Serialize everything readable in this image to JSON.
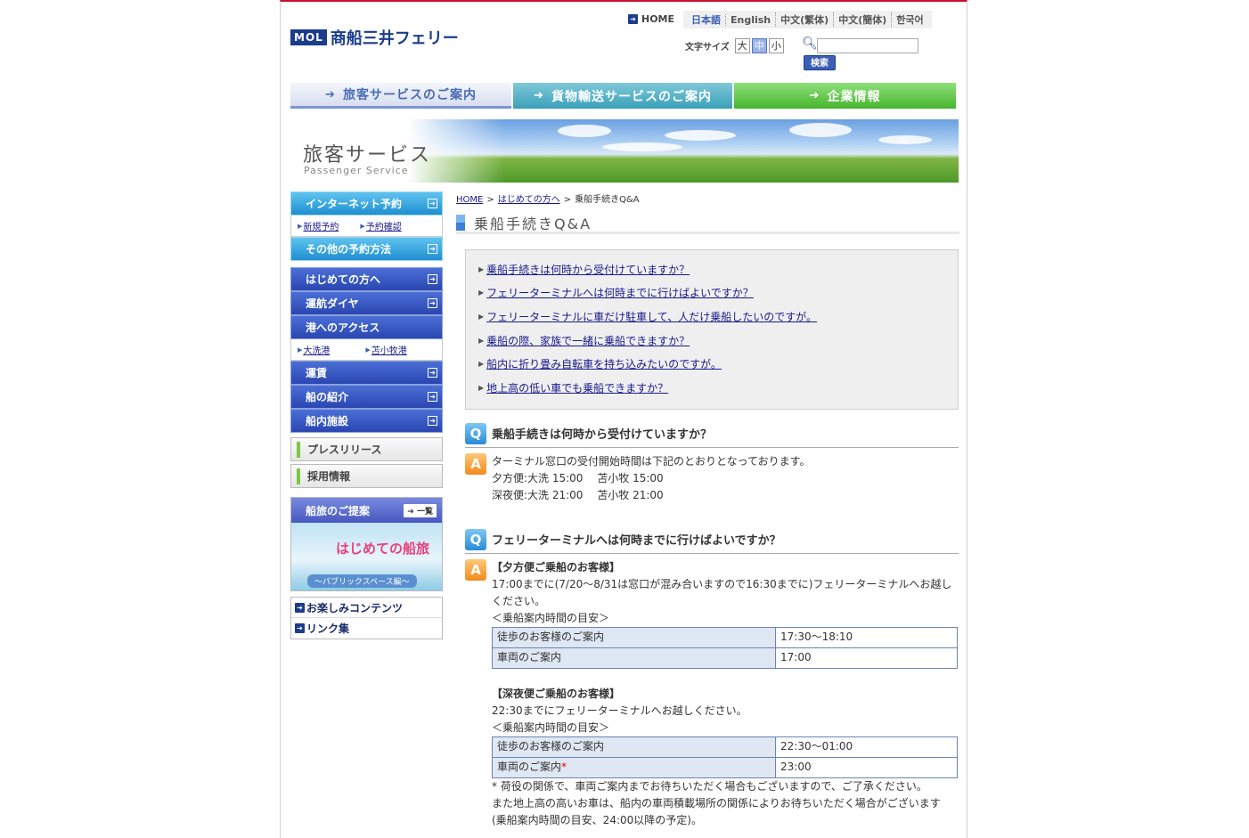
{
  "header": {
    "logo_mark": "MOL",
    "logo_text": "商船三井フェリー",
    "home": "HOME",
    "languages": [
      "日本語",
      "English",
      "中文(繁体)",
      "中文(簡体)",
      "한국어"
    ],
    "fontsize_label": "文字サイズ",
    "fontsizes": [
      "大",
      "中",
      "小"
    ],
    "search_button": "検索"
  },
  "mainnav": {
    "passenger": "旅客サービスのご案内",
    "cargo": "貨物輸送サービスのご案内",
    "company": "企業情報"
  },
  "banner": {
    "title": "旅客サービス",
    "subtitle": "Passenger Service"
  },
  "sidebar": {
    "internet": "インターネット予約",
    "new_booking": "新規予約",
    "confirm_booking": "予約確認",
    "other_booking": "その他の予約方法",
    "first_time": "はじめての方へ",
    "schedule": "運航ダイヤ",
    "access": "港へのアクセス",
    "port1": "大洗港",
    "port2": "苫小牧港",
    "fare": "運賃",
    "ships": "船の紹介",
    "facilities": "船内施設",
    "press": "プレスリリース",
    "recruit": "採用情報",
    "proposal": "船旅のご提案",
    "proposal_list": "一覧",
    "proposal_img_title": "はじめての船旅",
    "proposal_img_sub": "～パブリックスペース編～",
    "fun": "お楽しみコンテンツ",
    "links": "リンク集"
  },
  "content": {
    "breadcrumb": [
      "HOME",
      "はじめての方へ",
      "乗船手続きQ&A"
    ],
    "title": "乗船手続きQ&A",
    "toc": [
      "乗船手続きは何時から受付けていますか？",
      "フェリーターミナルへは何時までに行けばよいですか？",
      "フェリーターミナルに車だけ駐車して、人だけ乗船したいのですが。",
      "乗船の際、家族で一緒に乗船できますか？",
      "船内に折り畳み自転車を持ち込みたいのですが。",
      "地上高の低い車でも乗船できますか？"
    ],
    "q1": {
      "icon_q": "Q",
      "icon_a": "A",
      "question": "乗船手続きは何時から受付けていますか？",
      "answer": "ターミナル窓口の受付開始時間は下記のとおりとなっております。",
      "line1": "夕方便:大洗 15:00　 苫小牧 15:00",
      "line2": "深夜便:大洗 21:00　 苫小牧 21:00"
    },
    "q2": {
      "question": "フェリーターミナルへは何時までに行けばよいですか？",
      "eve_head": "【夕方便ご乗船のお客様】",
      "eve_text": "17:00までに(7/20～8/31は窓口が混み合いますので16:30までに)フェリーターミナルへお越しください。",
      "eve_guide": "＜乗船案内時間の目安＞",
      "eve_rows": [
        {
          "label": "徒歩のお客様のご案内",
          "value": "17:30～18:10"
        },
        {
          "label": "車両のご案内",
          "value": "17:00"
        }
      ],
      "night_head": "【深夜便ご乗船のお客様】",
      "night_text": "22:30までにフェリーターミナルへお越しください。",
      "night_guide": "＜乗船案内時間の目安＞",
      "night_rows": [
        {
          "label": "徒歩のお客様のご案内",
          "value": "22:30～01:00"
        },
        {
          "label": "車両のご案内",
          "value": "23:00"
        }
      ],
      "asterisk": "*",
      "note1": "* 荷役の関係で、車両ご案内までお待ちいただく場合もございますので、ご了承ください。",
      "note2": "また地上高の高いお車は、船内の車両積載場所の関係によりお待ちいただく場合がございます",
      "note3": "(乗船案内時間の目安、24:00以降の予定)。"
    }
  }
}
